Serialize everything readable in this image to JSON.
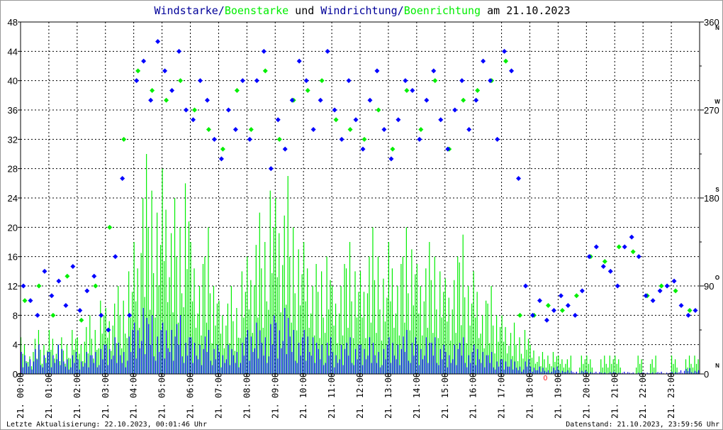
{
  "chart_data": {
    "type": "line",
    "title": {
      "part1": "Windstarke",
      "sep1": "/",
      "part2": "Boenstarke",
      "mid": " und ",
      "part3": "Windrichtung",
      "sep2": "/",
      "part4": "Boenrichtung",
      "tail": " am 21.10.2023"
    },
    "x_tick_labels": [
      "21. 00:00",
      "21. 01:00",
      "21. 02:00",
      "21. 03:00",
      "21. 04:00",
      "21. 05:00",
      "21. 06:00",
      "21. 07:00",
      "21. 08:00",
      "21. 09:00",
      "21. 10:00",
      "21. 11:00",
      "21. 12:00",
      "21. 13:00",
      "21. 14:00",
      "21. 15:00",
      "21. 16:00",
      "21. 17:00",
      "21. 18:00",
      "21. 19:00",
      "21. 20:00",
      "21. 21:00",
      "21. 22:00",
      "21. 23:00"
    ],
    "x_range_hours": [
      0,
      24
    ],
    "y_left": {
      "range": [
        0,
        48
      ],
      "ticks": [
        "0",
        "4",
        "8",
        "12",
        "16",
        "20",
        "24",
        "28",
        "32",
        "36",
        "40",
        "44",
        "48"
      ]
    },
    "y_right": {
      "range": [
        0,
        360
      ],
      "ticks": [
        "0",
        "90",
        "180",
        "270",
        "360"
      ],
      "compass": [
        "N",
        "O",
        "S",
        "W",
        "N"
      ]
    },
    "grid": true,
    "colors": {
      "wind": "#0000ff",
      "gust": "#00ee00",
      "title_blue": "#000099",
      "title_green": "#00ee00",
      "grid": "#000000",
      "zero_marker": "#ff0000"
    },
    "sample_interval_minutes": 15,
    "series": [
      {
        "name": "Windstarke",
        "axis": "left",
        "values": [
          3,
          2,
          4,
          3,
          3,
          4,
          2,
          3,
          2,
          3,
          3,
          4,
          4,
          5,
          3,
          6,
          7,
          9,
          8,
          6,
          7,
          6,
          8,
          5,
          5,
          4,
          6,
          4,
          3,
          4,
          3,
          5,
          6,
          7,
          5,
          8,
          7,
          9,
          6,
          5,
          6,
          5,
          4,
          5,
          3,
          4,
          5,
          4,
          4,
          5,
          3,
          4,
          5,
          4,
          6,
          5,
          4,
          5,
          5,
          4,
          3,
          4,
          5,
          3,
          4,
          3,
          3,
          2,
          2,
          2,
          1,
          2,
          1,
          1,
          0.5,
          1,
          0.5,
          0.5,
          0.3,
          0.5,
          0.3,
          0.3,
          0.2,
          0.3,
          0.2,
          0.3,
          0.2,
          0.2,
          0.2,
          0.2,
          0.3,
          0.2,
          0.3,
          0.5,
          0.8,
          0.5
        ]
      },
      {
        "name": "Boenstarke",
        "axis": "left",
        "values": [
          5,
          3,
          6,
          4,
          6,
          5,
          4,
          6,
          5,
          8,
          6,
          10,
          9,
          12,
          10,
          14,
          18,
          30,
          25,
          22,
          28,
          24,
          20,
          26,
          18,
          15,
          20,
          12,
          10,
          12,
          9,
          14,
          16,
          22,
          18,
          25,
          24,
          27,
          20,
          17,
          18,
          15,
          14,
          16,
          12,
          15,
          18,
          14,
          14,
          20,
          16,
          13,
          18,
          15,
          20,
          17,
          15,
          18,
          16,
          14,
          13,
          16,
          19,
          12,
          14,
          10,
          12,
          8,
          8,
          7,
          5,
          6,
          4,
          3,
          2.5,
          3,
          2.5,
          2.5,
          0,
          2.5,
          2.5,
          0,
          2.5,
          2.5,
          2.5,
          0,
          0,
          2.5,
          0,
          2.5,
          0,
          0,
          2.5,
          0,
          2.5,
          2.5
        ]
      },
      {
        "name": "Windrichtung",
        "axis": "right",
        "values": [
          90,
          75,
          60,
          105,
          80,
          95,
          70,
          110,
          65,
          85,
          100,
          60,
          45,
          120,
          200,
          60,
          300,
          320,
          280,
          340,
          310,
          290,
          330,
          270,
          260,
          300,
          280,
          240,
          220,
          270,
          250,
          300,
          240,
          300,
          330,
          210,
          260,
          230,
          280,
          320,
          300,
          250,
          280,
          330,
          270,
          240,
          300,
          260,
          230,
          280,
          310,
          250,
          220,
          260,
          300,
          290,
          240,
          280,
          310,
          260,
          230,
          270,
          300,
          250,
          280,
          320,
          300,
          240,
          330,
          310,
          200,
          90,
          60,
          75,
          55,
          65,
          80,
          70,
          60,
          85,
          120,
          130,
          110,
          105,
          90,
          130,
          140,
          120,
          80,
          75,
          85,
          90,
          95,
          70,
          60,
          65
        ]
      },
      {
        "name": "Boenrichtung",
        "axis": "right",
        "interval_minutes": 30,
        "values": [
          75,
          90,
          60,
          100,
          55,
          90,
          150,
          240,
          310,
          290,
          280,
          300,
          270,
          250,
          230,
          290,
          250,
          310,
          240,
          280,
          290,
          300,
          260,
          250,
          240,
          270,
          230,
          290,
          250,
          300,
          230,
          280,
          290,
          300,
          320,
          60,
          60,
          70,
          65,
          80,
          120,
          115,
          130,
          125,
          80,
          90,
          85,
          65
        ]
      }
    ],
    "zero_marker_label": "0"
  },
  "footer": {
    "last_update": "Letzte Aktualisierung: 22.10.2023, 00:01:46 Uhr",
    "data_state": "Datenstand: 21.10.2023, 23:59:56 Uhr"
  }
}
